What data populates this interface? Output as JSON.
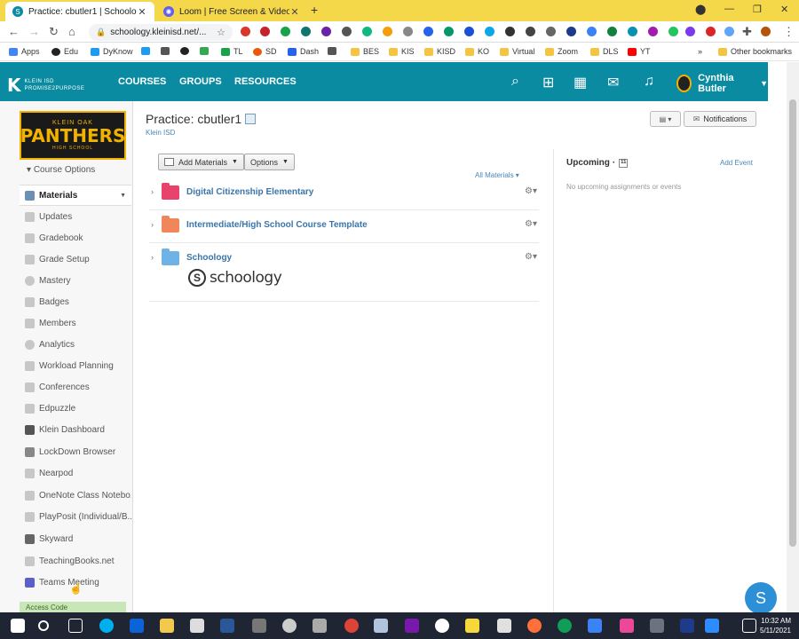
{
  "browser": {
    "tabs": [
      {
        "title": "Practice: cbutler1 | Schoology",
        "active": true
      },
      {
        "title": "Loom | Free Screen & Video Reco",
        "active": false
      }
    ],
    "new_tab": "+",
    "url": "schoology.kleinisd.net/...",
    "bookmarks": [
      "Apps",
      "Edu",
      "DyKnow",
      "TL",
      "SD",
      "Dash",
      "BES",
      "KIS",
      "KISD",
      "KO",
      "Virtual",
      "Zoom",
      "DLS",
      "YT"
    ],
    "more": "»",
    "other_bookmarks": "Other bookmarks"
  },
  "header": {
    "logo_k": "K",
    "logo_line1": "KLEIN ISD",
    "logo_line2": "PROMISE2PURPOSE",
    "nav": [
      "COURSES",
      "GROUPS",
      "RESOURCES"
    ],
    "user_name": "Cynthia Butler",
    "brand_color": "#0a8ba1"
  },
  "sidebar": {
    "banner_top": "KLEIN OAK",
    "banner_main": "PANTHERS",
    "banner_bottom": "HIGH SCHOOL",
    "course_options": "Course Options",
    "items": [
      {
        "label": "Materials",
        "active": true
      },
      {
        "label": "Updates"
      },
      {
        "label": "Gradebook"
      },
      {
        "label": "Grade Setup"
      },
      {
        "label": "Mastery"
      },
      {
        "label": "Badges"
      },
      {
        "label": "Members"
      },
      {
        "label": "Analytics"
      },
      {
        "label": "Workload Planning"
      },
      {
        "label": "Conferences"
      },
      {
        "label": "Edpuzzle"
      },
      {
        "label": "Klein Dashboard"
      },
      {
        "label": "LockDown Browser"
      },
      {
        "label": "Nearpod"
      },
      {
        "label": "OneNote Class Notebo..."
      },
      {
        "label": "PlayPosit (Individual/B..."
      },
      {
        "label": "Skyward"
      },
      {
        "label": "TeachingBooks.net"
      },
      {
        "label": "Teams Meeting"
      }
    ],
    "access_code": "Access Code"
  },
  "main": {
    "title": "Practice: cbutler1",
    "subtitle": "Klein ISD",
    "notifications": "Notifications",
    "add_materials": "Add Materials",
    "options": "Options",
    "filter": "All Materials",
    "folders": [
      {
        "name": "Digital Citizenship Elementary",
        "color": "#e8436b"
      },
      {
        "name": "Intermediate/High School Course Template",
        "color": "#f0875a"
      },
      {
        "name": "Schoology",
        "color": "#6fb3e6"
      }
    ],
    "schoology_logo_text": "schoology"
  },
  "upcoming": {
    "title": "Upcoming",
    "add_event": "Add Event",
    "empty": "No upcoming assignments or events"
  },
  "fab_letter": "S",
  "taskbar": {
    "time": "10:32 AM",
    "date": "5/11/2021"
  }
}
